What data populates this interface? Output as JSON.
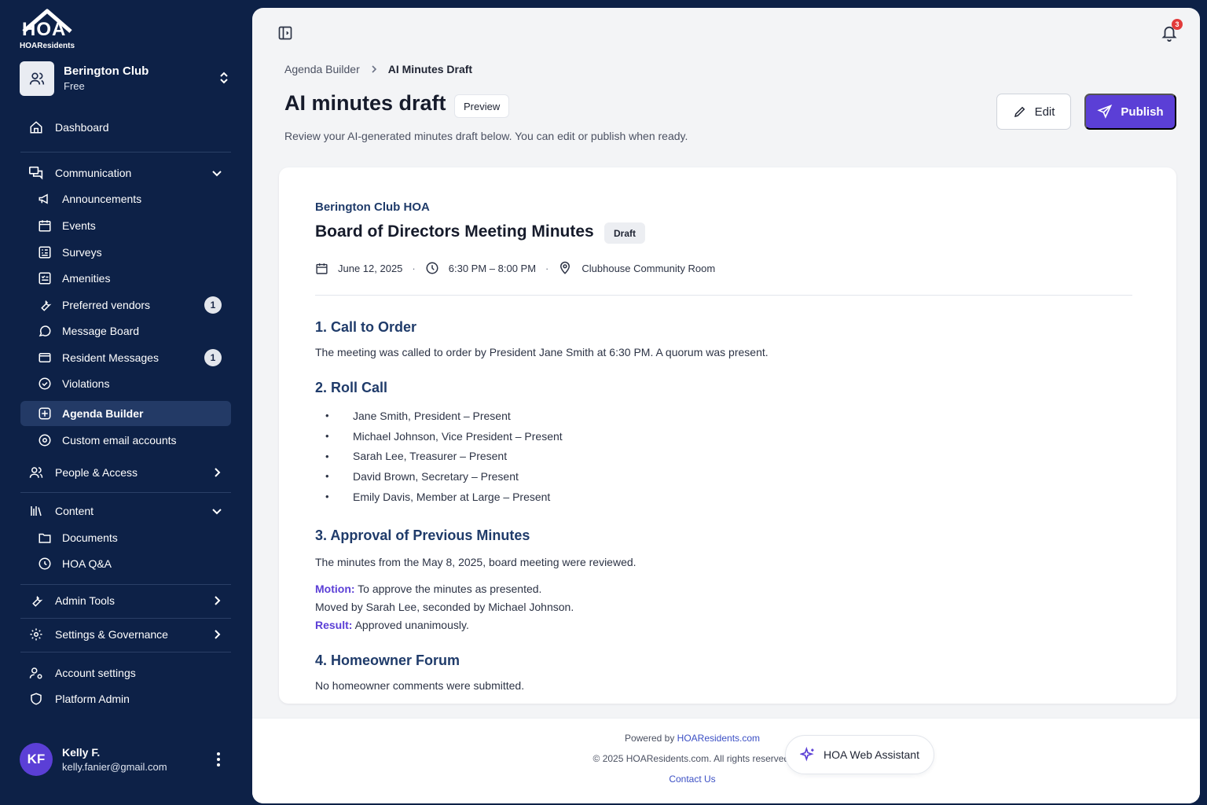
{
  "brand": {
    "logo_text": "HOA",
    "name": "HOAResidents"
  },
  "club": {
    "name": "Berington Club",
    "plan": "Free"
  },
  "nav": {
    "dashboard": "Dashboard",
    "communication": "Communication",
    "announcements": "Announcements",
    "events": "Events",
    "surveys": "Surveys",
    "amenities": "Amenities",
    "preferred_vendors": "Preferred vendors",
    "preferred_vendors_badge": "1",
    "message_board": "Message Board",
    "resident_messages": "Resident Messages",
    "resident_messages_badge": "1",
    "violations": "Violations",
    "agenda_builder": "Agenda Builder",
    "custom_email": "Custom email accounts",
    "people_access": "People & Access",
    "content": "Content",
    "documents": "Documents",
    "hoa_qa": "HOA Q&A",
    "admin_tools": "Admin Tools",
    "settings_governance": "Settings & Governance",
    "account_settings": "Account settings",
    "platform_admin": "Platform Admin"
  },
  "user": {
    "initials": "KF",
    "name": "Kelly F.",
    "email": "kelly.fanier@gmail.com"
  },
  "header": {
    "notifications_count": "3"
  },
  "breadcrumb": {
    "parent": "Agenda Builder",
    "current": "AI Minutes Draft"
  },
  "page": {
    "title": "AI minutes draft",
    "preview_label": "Preview",
    "subtitle": "Review your AI-generated minutes draft below. You can edit or publish when ready.",
    "edit_label": "Edit",
    "publish_label": "Publish"
  },
  "minutes": {
    "org": "Berington Club HOA",
    "title": "Board of Directors Meeting Minutes",
    "status": "Draft",
    "date": "June 12, 2025",
    "time": "6:30 PM – 8:00 PM",
    "location": "Clubhouse Community Room",
    "sections": [
      {
        "heading": "1. Call to Order",
        "text": "The meeting was called to order by President Jane Smith at 6:30 PM. A quorum was present."
      },
      {
        "heading": "2. Roll Call"
      },
      {
        "heading": "3. Approval of Previous Minutes",
        "text": "The minutes from the May 8, 2025, board meeting were reviewed."
      },
      {
        "heading": "4. Homeowner Forum",
        "text": "No homeowner comments were submitted."
      }
    ],
    "roll_call": [
      "Jane Smith, President – Present",
      "Michael Johnson, Vice President – Present",
      "Sarah Lee, Treasurer – Present",
      "David Brown, Secretary – Present",
      "Emily Davis, Member at Large – Present"
    ],
    "motion_label": "Motion:",
    "motion_text": " To approve the minutes as presented.",
    "moved_text": "Moved by Sarah Lee, seconded by Michael Johnson.",
    "result_label": "Result:",
    "result_text": " Approved unanimously."
  },
  "footer": {
    "powered_prefix": "Powered by ",
    "powered_link": "HOAResidents.com",
    "copyright": "© 2025 HOAResidents.com. All rights reserved.",
    "contact": "Contact Us"
  },
  "assistant": {
    "label": "HOA Web Assistant"
  },
  "colors": {
    "sidebar_bg": "#0d2147",
    "accent": "#5b3fd6",
    "heading": "#1f3b6a",
    "badge_red": "#e23b3b"
  }
}
